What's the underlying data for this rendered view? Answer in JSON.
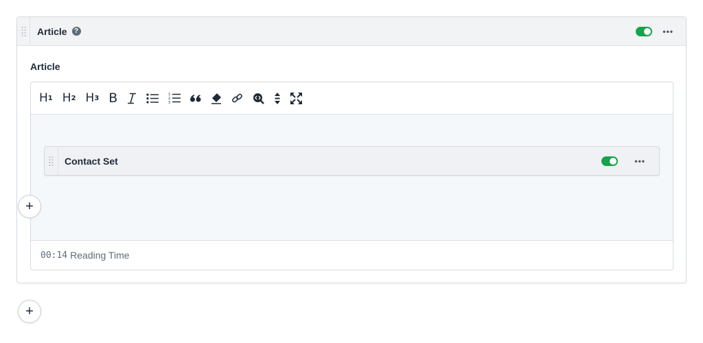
{
  "set": {
    "title": "Article",
    "help_icon": "question-circle-icon",
    "enabled": true,
    "more_label": "•••"
  },
  "field": {
    "label": "Article"
  },
  "toolbar": {
    "buttons": [
      {
        "name": "heading-1",
        "glyph": "H",
        "sub": "1"
      },
      {
        "name": "heading-2",
        "glyph": "H",
        "sub": "2"
      },
      {
        "name": "heading-3",
        "glyph": "H",
        "sub": "3"
      },
      {
        "name": "bold",
        "glyph": "B"
      },
      {
        "name": "italic",
        "glyph": "I"
      },
      {
        "name": "bullet-list"
      },
      {
        "name": "ordered-list"
      },
      {
        "name": "quote",
        "glyph": "66"
      },
      {
        "name": "clear-format"
      },
      {
        "name": "link"
      },
      {
        "name": "code"
      },
      {
        "name": "expand-vertical"
      },
      {
        "name": "fullscreen"
      }
    ]
  },
  "inner_set": {
    "title": "Contact Set",
    "enabled": true,
    "more_label": "•••"
  },
  "footer": {
    "time": "00:14",
    "label": "Reading Time"
  },
  "add_button_label": "+"
}
